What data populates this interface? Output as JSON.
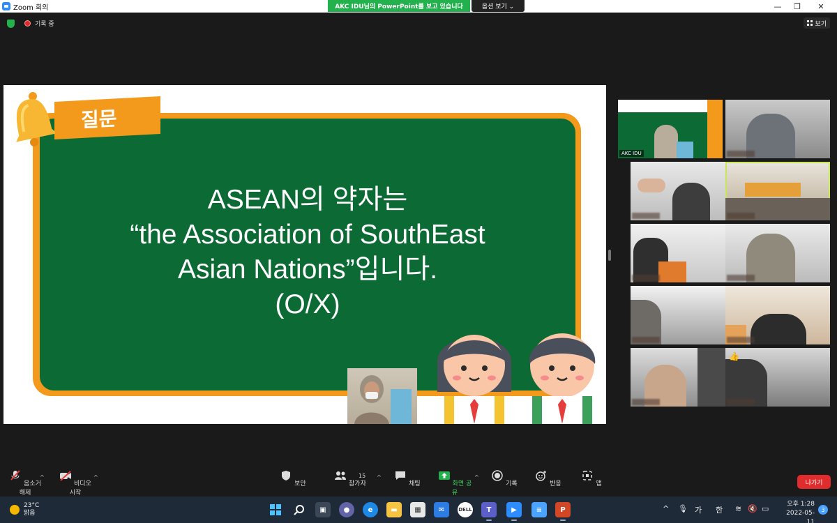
{
  "window": {
    "title": "Zoom 회의",
    "share_banner": "AKC IDU님의 PowerPoint를 보고 있습니다",
    "view_options": "옵션 보기 ⌄",
    "recording_status": "기록 중",
    "view_button": "보기"
  },
  "slide": {
    "tag": "질문",
    "lines": [
      "ASEAN의 약자는",
      "“the Association of SouthEast",
      "Asian Nations”입니다.",
      "(O/X)"
    ]
  },
  "gallery": {
    "presenter_name": "AKC IDU"
  },
  "toolbar": {
    "unmute": "음소거 해제",
    "start_video": "비디오 시작",
    "security": "보안",
    "participants": "참가자",
    "participants_count": "15",
    "chat": "채팅",
    "share_screen": "화면 공유",
    "record": "기록",
    "reactions": "반응",
    "apps": "앱",
    "leave": "나가기"
  },
  "taskbar": {
    "temperature": "23°C",
    "weather": "맑음",
    "ime_lang": "가",
    "ime_mode": "한",
    "clock_period_time": "오후 1:28",
    "date": "2022-05-11",
    "notifications": "3"
  },
  "colors": {
    "share_banner": "#23b14d",
    "board_green": "#0c6a34",
    "board_orange": "#f39a1c",
    "leave_red": "#e02c2c",
    "active_speaker": "#c9e65a"
  }
}
